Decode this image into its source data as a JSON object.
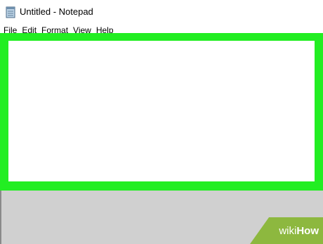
{
  "window": {
    "title": "Untitled - Notepad",
    "icon": "notepad-icon"
  },
  "menubar": {
    "items": [
      "File",
      "Edit",
      "Format",
      "View",
      "Help"
    ]
  },
  "editor": {
    "content": "",
    "highlight_color": "#22ee22"
  },
  "watermark": {
    "prefix": "wiki",
    "suffix": "How",
    "color": "#8db83f"
  }
}
